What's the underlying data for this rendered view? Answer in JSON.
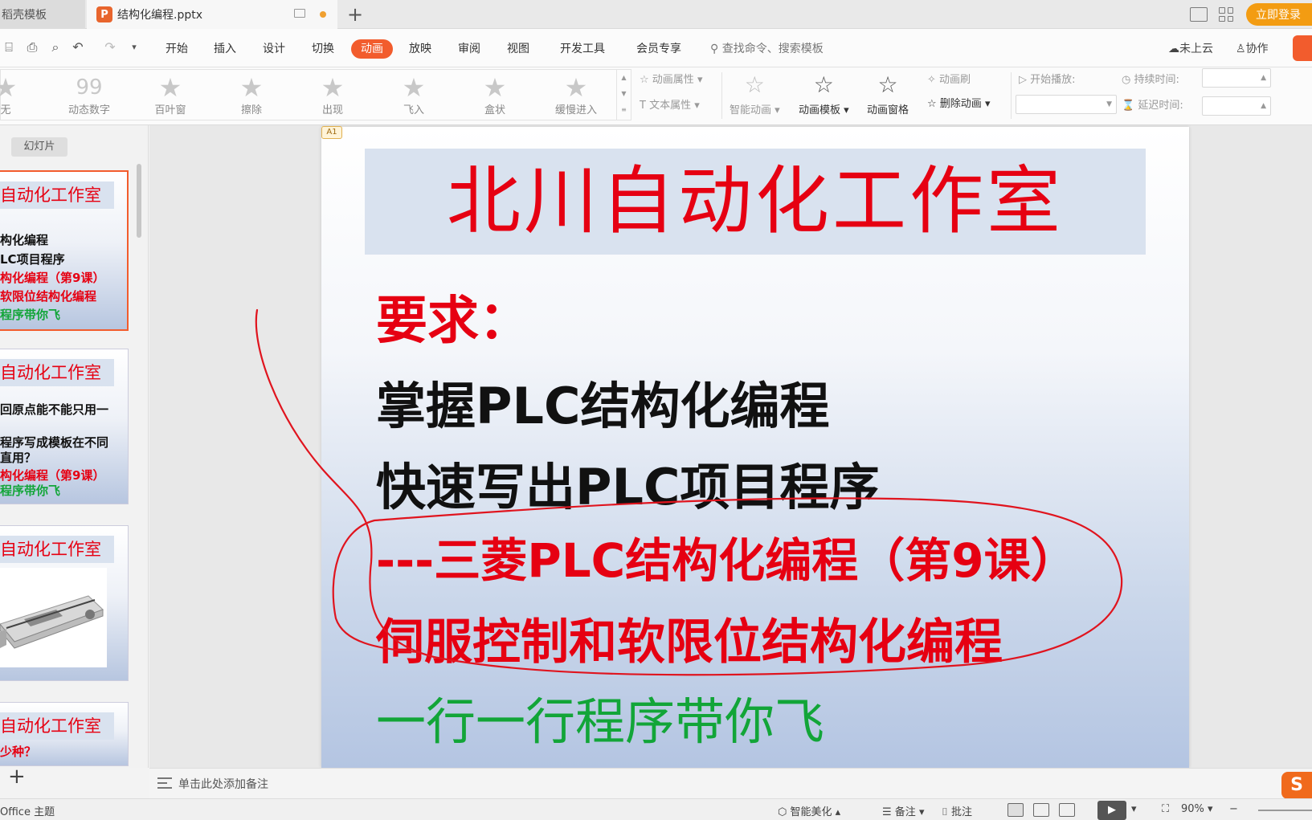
{
  "titlebar": {
    "template_tab": "稻壳模板",
    "file_tab": "结构化编程.pptx",
    "new_tab": "+",
    "login_button": "立即登录"
  },
  "menu": {
    "items": [
      "开始",
      "插入",
      "设计",
      "切换",
      "动画",
      "放映",
      "审阅",
      "视图",
      "开发工具",
      "会员专享"
    ],
    "active": "动画",
    "search_placeholder": "查找命令、搜索模板",
    "cloud": "未上云",
    "collab": "协作"
  },
  "ribbon": {
    "effects": [
      "无",
      "动态数字",
      "百叶窗",
      "擦除",
      "出现",
      "飞入",
      "盒状",
      "缓慢进入"
    ],
    "anim_props": "动画属性",
    "text_props": "文本属性",
    "smart_anim": "智能动画",
    "anim_template": "动画模板",
    "anim_pane": "动画窗格",
    "anim_brush": "动画刷",
    "delete_anim": "删除动画",
    "start_play": "开始播放:",
    "duration": "持续时间:",
    "delay": "延迟时间:"
  },
  "left_panel": {
    "tab_label": "幻灯片",
    "thumbs": [
      {
        "title": "自动化工作室",
        "lines": [
          {
            "text": "构化编程",
            "color": "black"
          },
          {
            "text": "LC项目程序",
            "color": "black"
          },
          {
            "text": "构化编程（第9课）",
            "color": "red"
          },
          {
            "text": "软限位结构化编程",
            "color": "red"
          },
          {
            "text": "程序带你飞",
            "color": "green"
          }
        ]
      },
      {
        "title": "自动化工作室",
        "lines": [
          {
            "text": "回原点能不能只用一",
            "color": "black"
          },
          {
            "text": "程序写成模板在不同",
            "color": "black"
          },
          {
            "text": "直用？",
            "color": "black"
          },
          {
            "text": "构化编程（第9课）",
            "color": "red"
          },
          {
            "text": "程序带你飞",
            "color": "green"
          }
        ]
      },
      {
        "title": "自动化工作室",
        "lines": []
      },
      {
        "title": "自动化工作室",
        "lines": [
          {
            "text": "少种？",
            "color": "red"
          }
        ]
      }
    ]
  },
  "slide": {
    "tag": "A1",
    "title": "北川自动化工作室",
    "requirement": "要求：",
    "line1": "掌握PLC结构化编程",
    "line2": "快速写出PLC项目程序",
    "line3": "---三菱PLC结构化编程（第9课）",
    "line4": "伺服控制和软限位结构化编程",
    "line5": "一行一行程序带你飞"
  },
  "notes": {
    "placeholder": "单击此处添加备注"
  },
  "status": {
    "theme": "Office 主题",
    "beautify": "智能美化",
    "notes": "备注",
    "comments": "批注",
    "zoom": "90%"
  },
  "colors": {
    "accent": "#f25c2d",
    "title_red": "#e60012",
    "green": "#12a538",
    "login_orange": "#f39c12",
    "annotation_red": "#e0141e"
  }
}
